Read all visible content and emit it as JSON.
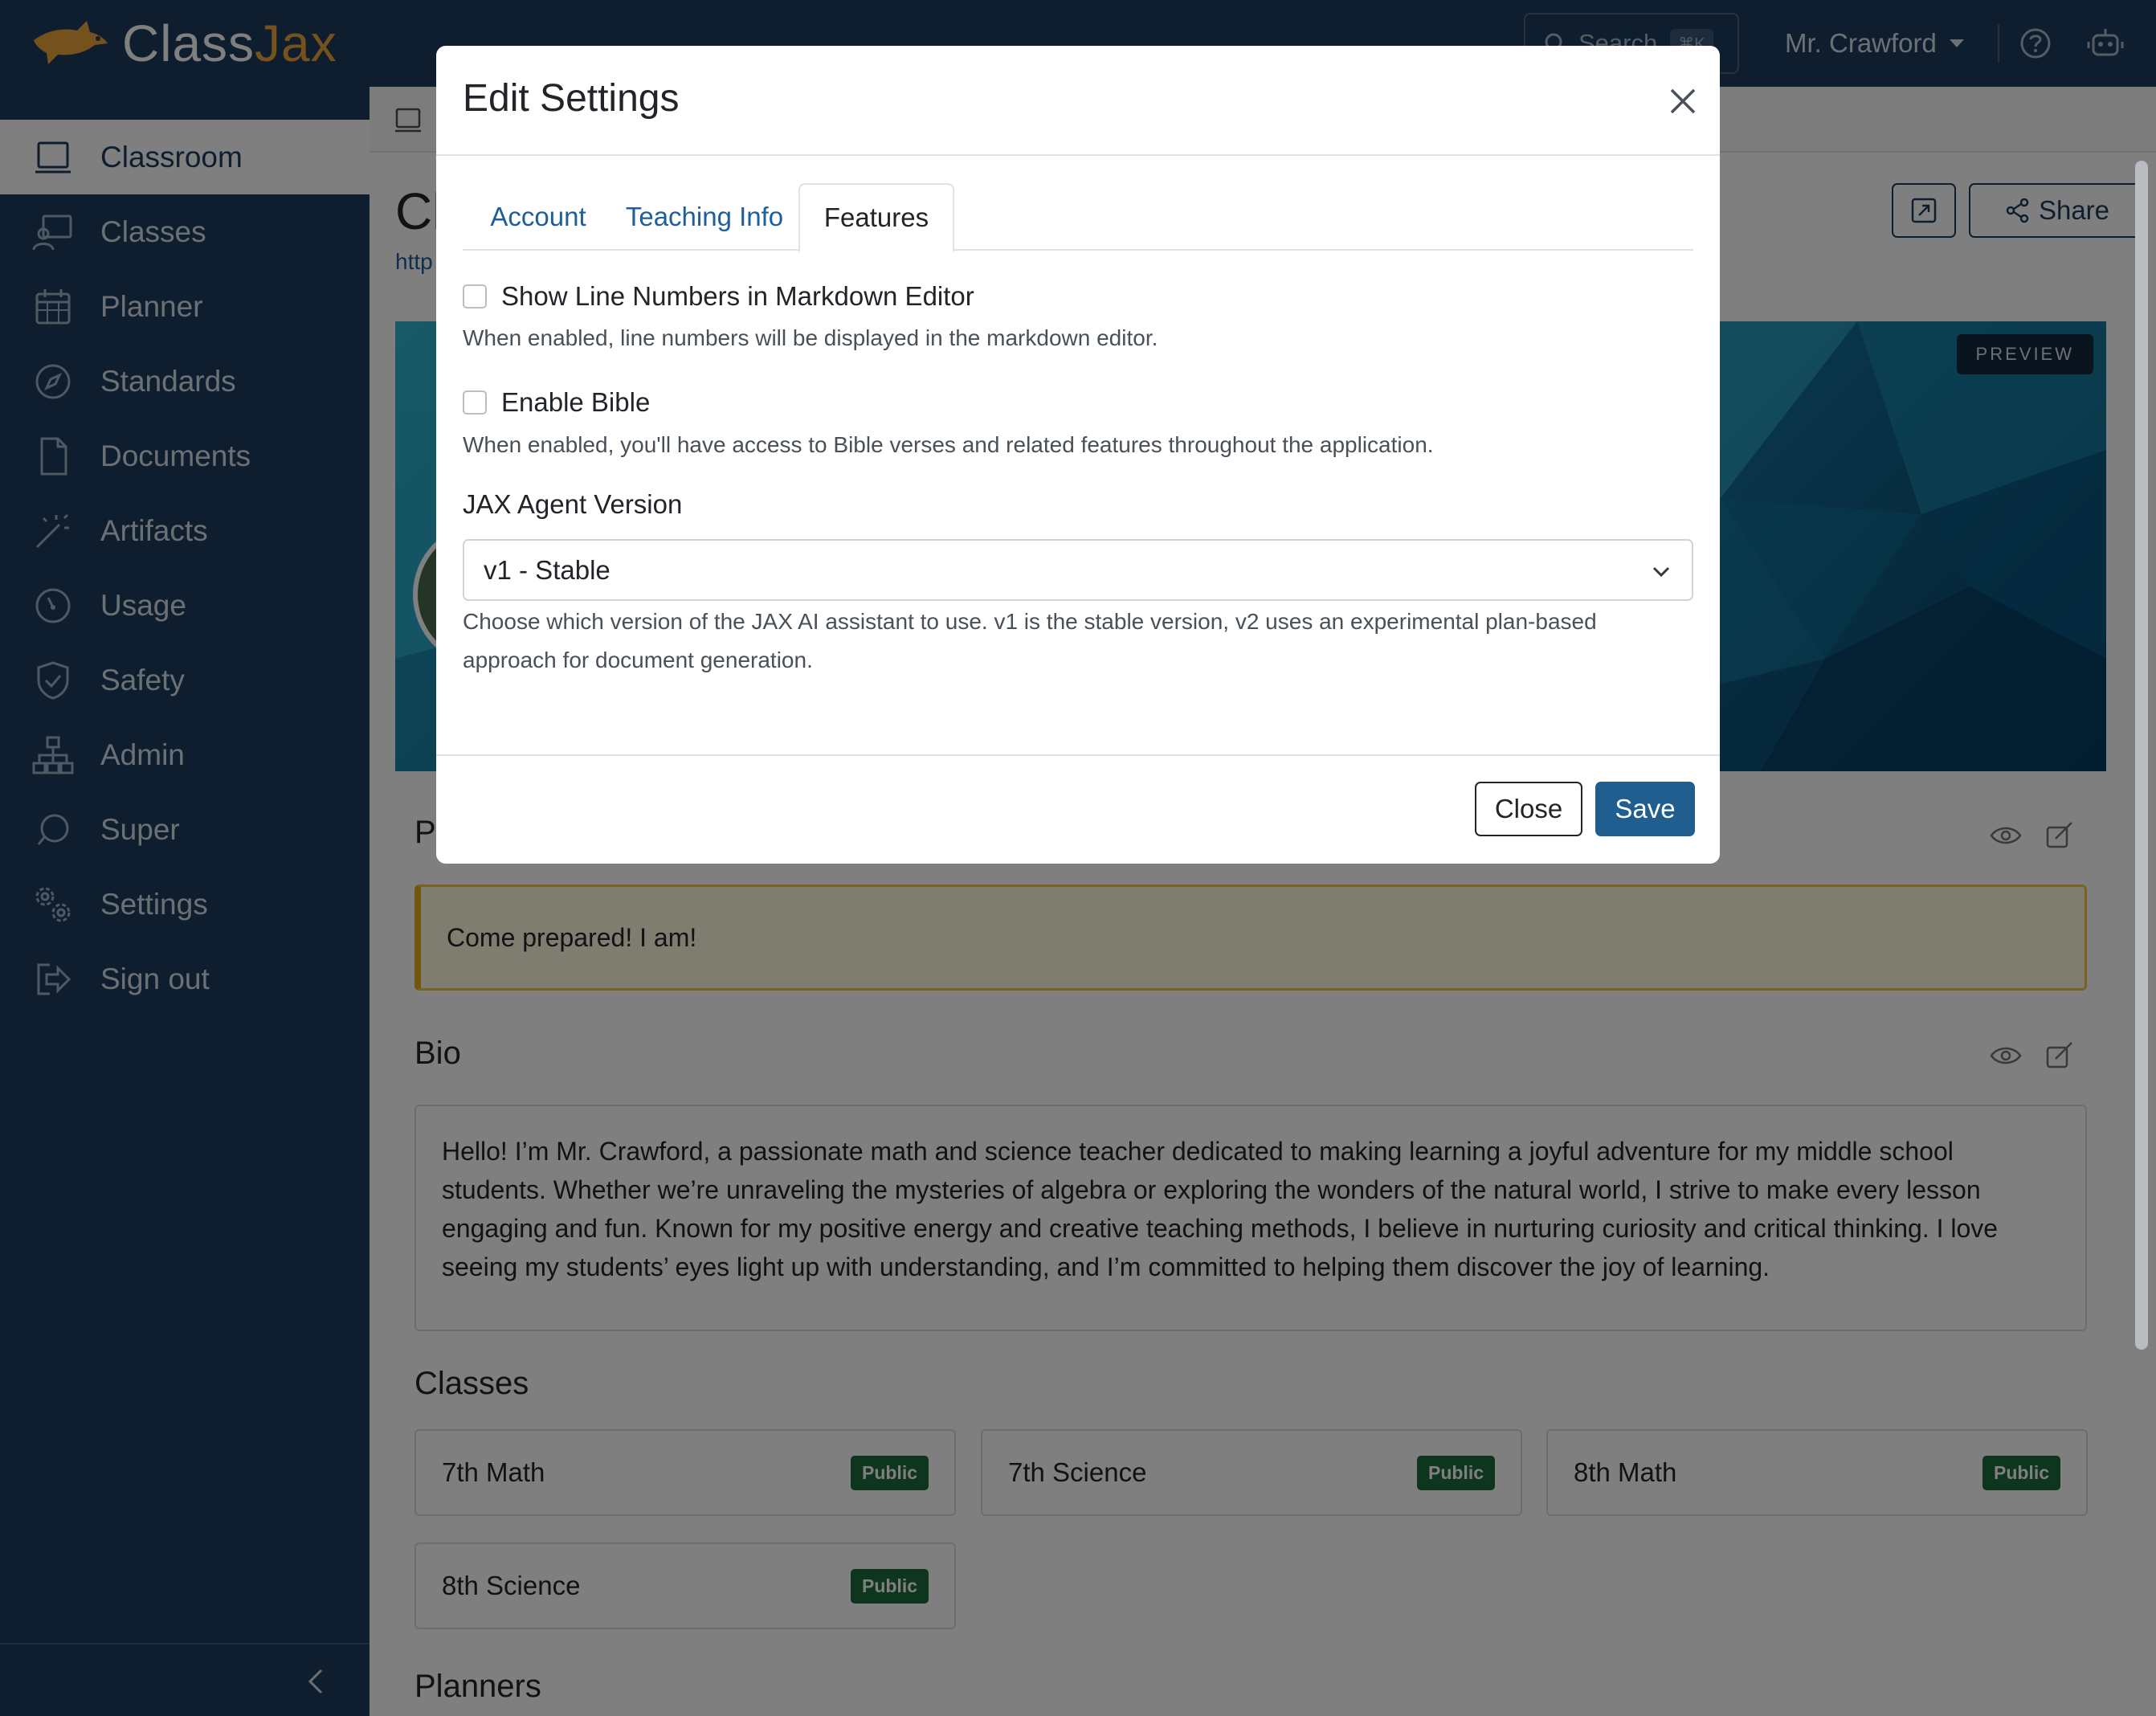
{
  "app": {
    "brand_part1": "Class",
    "brand_part2": "Jax"
  },
  "topbar": {
    "search_placeholder": "Search",
    "search_shortcut": "⌘K",
    "user_name": "Mr. Crawford"
  },
  "sidebar": {
    "items": [
      {
        "label": "Classroom",
        "icon": "monitor-icon",
        "active": true
      },
      {
        "label": "Classes",
        "icon": "teacher-icon"
      },
      {
        "label": "Planner",
        "icon": "calendar-icon"
      },
      {
        "label": "Standards",
        "icon": "compass-icon"
      },
      {
        "label": "Documents",
        "icon": "document-icon"
      },
      {
        "label": "Artifacts",
        "icon": "magic-wand-icon"
      },
      {
        "label": "Usage",
        "icon": "speedometer-icon"
      },
      {
        "label": "Safety",
        "icon": "shield-check-icon"
      },
      {
        "label": "Admin",
        "icon": "org-chart-icon"
      },
      {
        "label": "Super",
        "icon": "ring-icon"
      },
      {
        "label": "Settings",
        "icon": "gears-icon"
      },
      {
        "label": "Sign out",
        "icon": "sign-out-icon"
      }
    ]
  },
  "page": {
    "title": "Cl",
    "url": "http",
    "share_label": "Share",
    "preview_badge": "PREVIEW",
    "motto_heading": "P",
    "motto": "Come prepared! I am!",
    "bio_heading": "Bio",
    "bio": "Hello! I’m Mr. Crawford, a passionate math and science teacher dedicated to making learning a joyful adventure for my middle school students. Whether we’re unraveling the mysteries of algebra or exploring the wonders of the natural world, I strive to make every lesson engaging and fun. Known for my positive energy and creative teaching methods, I believe in nurturing curiosity and critical thinking. I love seeing my students’ eyes light up with understanding, and I’m committed to helping them discover the joy of learning.",
    "classes_heading": "Classes",
    "classes": [
      {
        "name": "7th Math",
        "badge": "Public"
      },
      {
        "name": "7th Science",
        "badge": "Public"
      },
      {
        "name": "8th Math",
        "badge": "Public"
      },
      {
        "name": "8th Science",
        "badge": "Public"
      }
    ],
    "planners_heading": "Planners"
  },
  "modal": {
    "title": "Edit Settings",
    "tabs": [
      {
        "label": "Account"
      },
      {
        "label": "Teaching Info"
      },
      {
        "label": "Features",
        "active": true
      }
    ],
    "options": [
      {
        "label": "Show Line Numbers in Markdown Editor",
        "checked": false,
        "help": "When enabled, line numbers will be displayed in the markdown editor."
      },
      {
        "label": "Enable Bible",
        "checked": false,
        "help": "When enabled, you'll have access to Bible verses and related features throughout the application."
      }
    ],
    "agent_version_label": "JAX Agent Version",
    "agent_version_value": "v1 - Stable",
    "agent_version_help": "Choose which version of the JAX AI assistant to use. v1 is the stable version, v2 uses an experimental plan-based approach for document generation.",
    "close_label": "Close",
    "save_label": "Save"
  },
  "colors": {
    "navy": "#1e3d5c",
    "accent": "#e8a33a",
    "primary": "#1f5e8f",
    "badge_green": "#1d6b3c",
    "motto_border": "#e5ac17"
  }
}
